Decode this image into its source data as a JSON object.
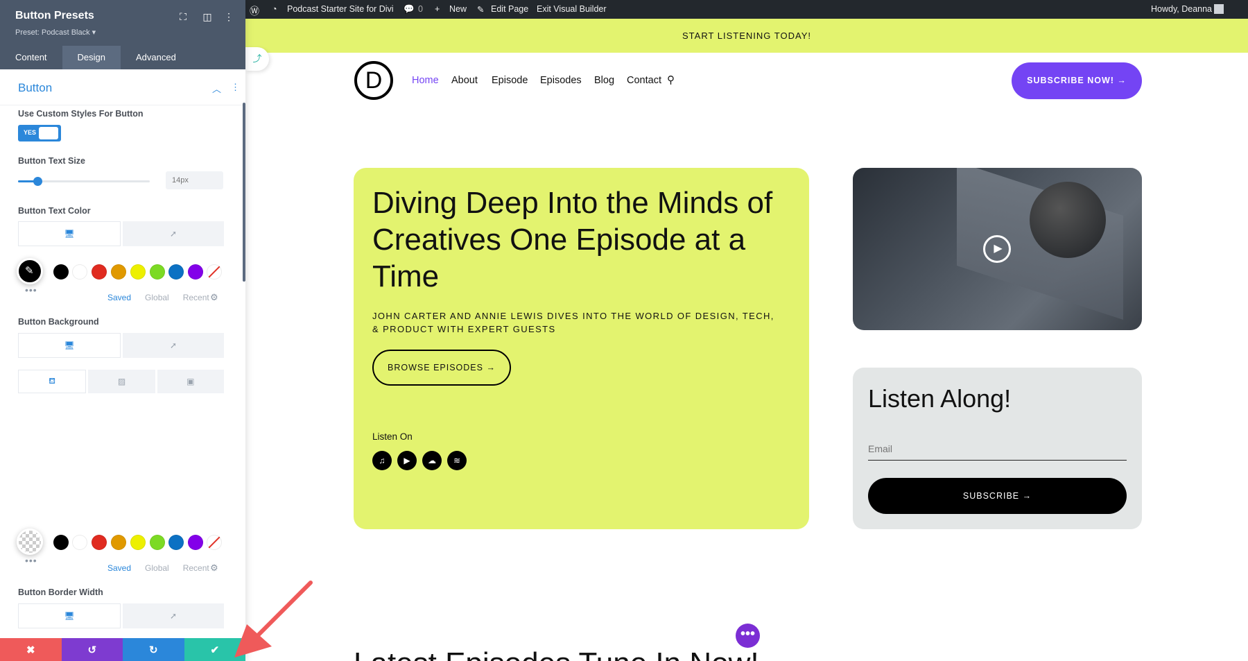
{
  "panel": {
    "title": "Button Presets",
    "subtitle": "Preset: Podcast Black ▾",
    "tabs": [
      "Content",
      "Design",
      "Advanced"
    ],
    "active_tab": "Design",
    "section_title": "Button",
    "fields": {
      "custom_styles_label": "Use Custom Styles For Button",
      "toggle_text": "YES",
      "text_size_label": "Button Text Size",
      "text_size_placeholder": "14px",
      "text_color_label": "Button Text Color",
      "background_label": "Button Background",
      "border_width_label": "Button Border Width"
    },
    "color_tabs": [
      "Saved",
      "Global",
      "Recent"
    ],
    "swatches": [
      "#000000",
      "#ffffff",
      "#e02b20",
      "#e09900",
      "#edf000",
      "#7cda24",
      "#0c71c3",
      "#8300e9"
    ],
    "bottom_bar": {
      "close_icon": "✖",
      "undo_icon": "↺",
      "redo_icon": "↻",
      "save_icon": "✔"
    },
    "colors": {
      "close": "#ef5a5a",
      "undo": "#7e3bd0",
      "redo": "#2b87da",
      "save": "#29c4a9"
    }
  },
  "adminbar": {
    "site_name": "Podcast Starter Site for Divi",
    "comments": "0",
    "new": "New",
    "edit_page": "Edit Page",
    "exit": "Exit Visual Builder",
    "howdy": "Howdy, Deanna"
  },
  "site": {
    "topbar": "START LISTENING TODAY!",
    "logo_letter": "D",
    "nav": [
      "Home",
      "About",
      "Episode",
      "Episodes",
      "Blog",
      "Contact"
    ],
    "subscribe_top": "SUBSCRIBE NOW! →",
    "hero_title": "Diving Deep Into the Minds of Creatives One Episode at a Time",
    "hero_subtitle": "JOHN CARTER AND ANNIE LEWIS DIVES INTO THE WORLD OF DESIGN, TECH, & PRODUCT WITH EXPERT GUESTS",
    "browse_button": "BROWSE EPISODES →",
    "listen_on": "Listen On",
    "newsletter_title": "Listen Along!",
    "email_placeholder": "Email",
    "newsletter_button": "SUBSCRIBE →",
    "latest_heading": "Latest Episodes Tune In Now!"
  }
}
